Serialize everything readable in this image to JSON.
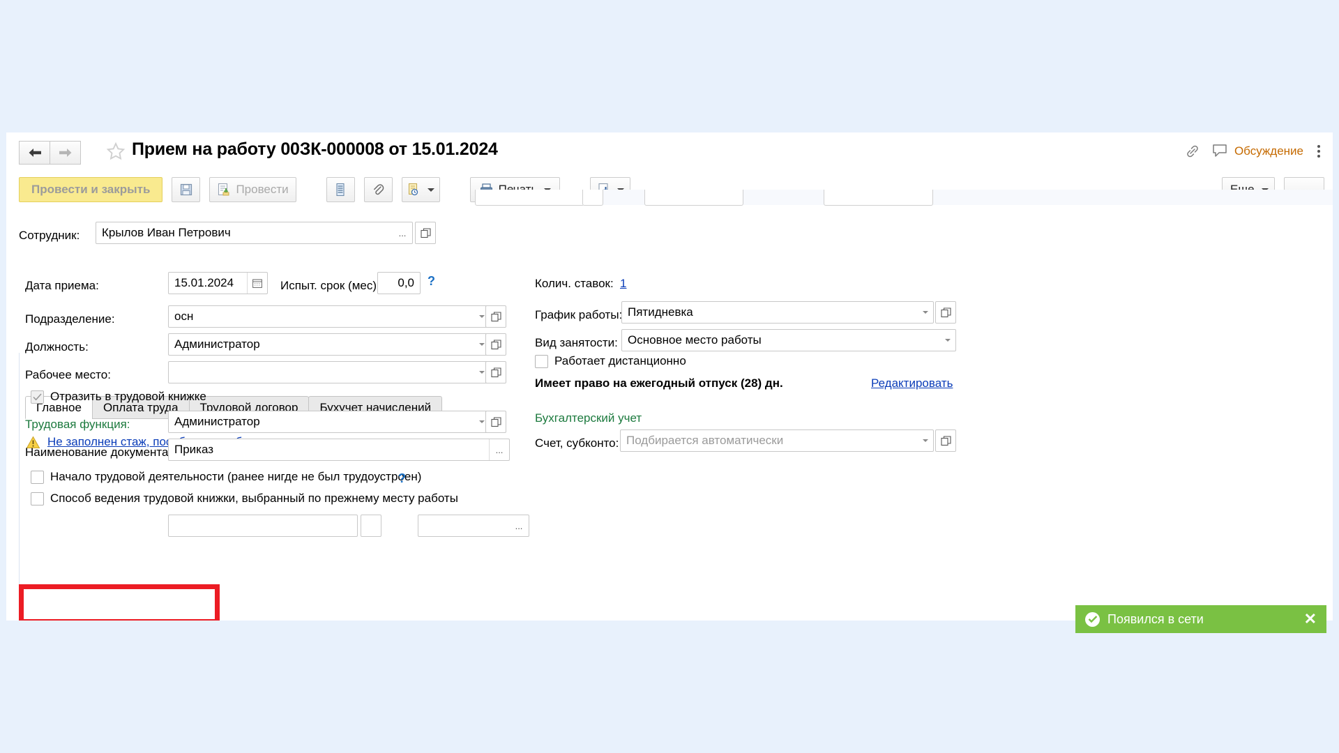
{
  "colors": {
    "desktop_bg": "#e8f1fc",
    "primary_button": "#f9ea8f",
    "highlight_red": "#ec1c24",
    "toast_green": "#7ac143",
    "link_blue": "#0a3cb8",
    "section_green": "#1c7a3e",
    "discussion_orange": "#c56a00"
  },
  "titlebar": {
    "back_icon": "arrow-left-icon",
    "forward_icon": "arrow-right-icon",
    "favorite_icon": "star-icon",
    "title": "Прием на работу 00ЗК-000008 от 15.01.2024",
    "link_icon": "link-icon",
    "discussion_icon": "speech-bubble-icon",
    "discussion_label": "Обсуждение",
    "menu_icon": "kebab-menu-icon"
  },
  "toolbar": {
    "post_and_close": "Провести и закрыть",
    "save_icon": "floppy-disk-icon",
    "post_label": "Провести",
    "post_icon": "post-document-icon",
    "register_icon": "register-list-icon",
    "attachment_icon": "paperclip-icon",
    "report_icon": "report-clock-icon",
    "print_label": "Печать",
    "print_icon": "printer-icon",
    "export_icon": "export-arrow-icon",
    "more_label": "Еще"
  },
  "employee": {
    "label": "Сотрудник:",
    "value": "Крылов Иван Петрович",
    "select_button": "...",
    "open_button": "open-card-icon"
  },
  "tabs": [
    {
      "label": "Главное",
      "active": true
    },
    {
      "label": "Оплата труда",
      "active": false
    },
    {
      "label": "Трудовой договор",
      "active": false
    },
    {
      "label": "Бухучет начислений",
      "active": false
    }
  ],
  "warning": {
    "icon": "warning-triangle-icon",
    "text": "Не заполнен стаж, пособия могут быть рассчитаны неверно"
  },
  "left_column": {
    "date_label": "Дата приема:",
    "date_value": "15.01.2024",
    "calendar_icon": "calendar-icon",
    "probation_label": "Испыт. срок (мес):",
    "probation_value": "0,0",
    "probation_help": "?",
    "division_label": "Подразделение:",
    "division_value": "осн",
    "position_label": "Должность:",
    "position_value": "Администратор",
    "workplace_label": "Рабочее место:",
    "workplace_value": "",
    "reflect_checkbox_label": "Отразить в трудовой книжке",
    "reflect_checkbox_checked": true,
    "labor_function_label": "Трудовая функция:",
    "labor_function_value": "Администратор",
    "document_name_label": "Наименование документа:",
    "document_name_value": "Приказ",
    "first_job_label": "Начало трудовой деятельности (ранее нигде не был трудоустроен)",
    "first_job_help": "?",
    "first_job_checked": false,
    "prev_method_label": "Способ ведения трудовой книжки, выбранный по прежнему месту работы",
    "prev_method_checked": false
  },
  "right_column": {
    "rates_label": "Колич. ставок:",
    "rates_value": "1",
    "schedule_label": "График работы:",
    "schedule_value": "Пятидневка",
    "employment_label": "Вид занятости:",
    "employment_value": "Основное место работы",
    "remote_label": "Работает дистанционно",
    "remote_checked": false,
    "vacation_text": "Имеет право на ежегодный отпуск (28) дн.",
    "vacation_edit_link": "Редактировать",
    "accounting_section": "Бухгалтерский учет",
    "account_label": "Счет, субконто:",
    "account_placeholder": "Подбирается автоматически"
  },
  "toast": {
    "icon": "check-circle-icon",
    "text": "Появился в сети",
    "close_icon": "close-icon"
  }
}
